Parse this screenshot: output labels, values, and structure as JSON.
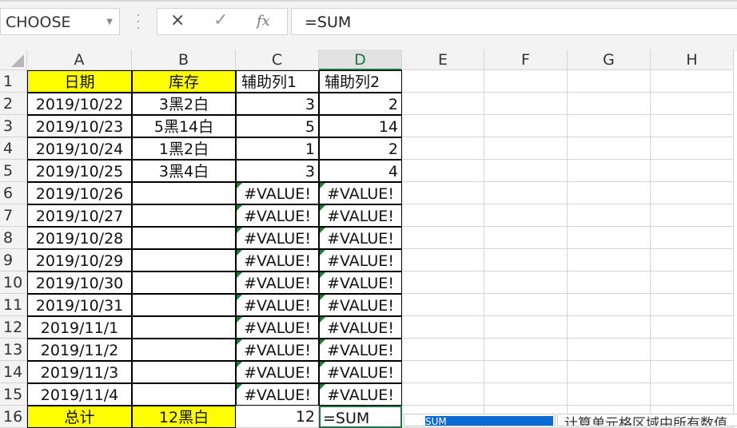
{
  "name_box": "CHOOSE",
  "formula_bar": "=SUM",
  "icons": {
    "cancel": "×",
    "enter": "✓",
    "fx": "fx"
  },
  "columns": [
    "A",
    "B",
    "C",
    "D",
    "E",
    "F",
    "G",
    "H"
  ],
  "rows": [
    [
      "日期",
      "库存",
      "辅助列1",
      "辅助列2"
    ],
    [
      "2019/10/22",
      "3黑2白",
      "3",
      "2"
    ],
    [
      "2019/10/23",
      "5黑14白",
      "5",
      "14"
    ],
    [
      "2019/10/24",
      "1黑2白",
      "1",
      "2"
    ],
    [
      "2019/10/25",
      "3黑4白",
      "3",
      "4"
    ],
    [
      "2019/10/26",
      "",
      "#VALUE!",
      "#VALUE!"
    ],
    [
      "2019/10/27",
      "",
      "#VALUE!",
      "#VALUE!"
    ],
    [
      "2019/10/28",
      "",
      "#VALUE!",
      "#VALUE!"
    ],
    [
      "2019/10/29",
      "",
      "#VALUE!",
      "#VALUE!"
    ],
    [
      "2019/10/30",
      "",
      "#VALUE!",
      "#VALUE!"
    ],
    [
      "2019/10/31",
      "",
      "#VALUE!",
      "#VALUE!"
    ],
    [
      "2019/11/1",
      "",
      "#VALUE!",
      "#VALUE!"
    ],
    [
      "2019/11/2",
      "",
      "#VALUE!",
      "#VALUE!"
    ],
    [
      "2019/11/3",
      "",
      "#VALUE!",
      "#VALUE!"
    ],
    [
      "2019/11/4",
      "",
      "#VALUE!",
      "#VALUE!"
    ],
    [
      "总计",
      "12黑白",
      "12",
      "=SUM"
    ]
  ],
  "autocomplete": {
    "selected": "SUM",
    "tooltip": "计算单元格区域中所有数值"
  },
  "colors": {
    "highlight": "#ffff00",
    "error_marker": "#1e7e34",
    "selection": "#217346"
  }
}
